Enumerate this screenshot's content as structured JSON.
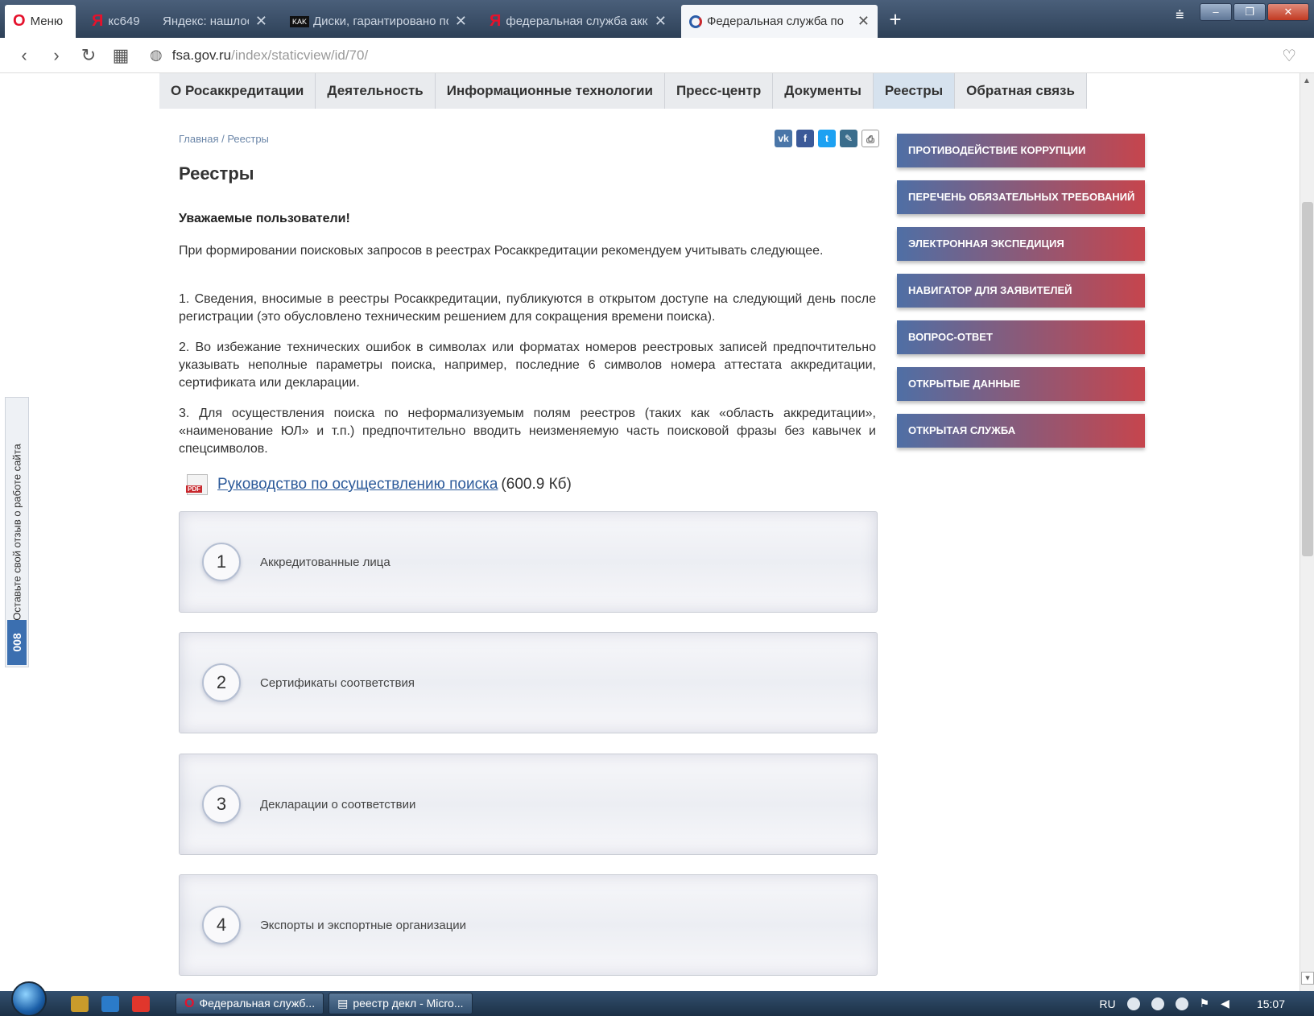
{
  "browser": {
    "tabs": [
      {
        "label": "Меню",
        "icon": "opera-logo-icon"
      },
      {
        "label": "кс649",
        "icon": "yandex-icon"
      },
      {
        "label": "Яндекс: нашлось",
        "icon": "none"
      },
      {
        "label": "Диски, гарантировано по",
        "icon": "kak-site-icon"
      },
      {
        "label": "федеральная служба акк",
        "icon": "yandex-icon"
      },
      {
        "label": "Федеральная служба по",
        "icon": "fsa-logo-icon",
        "active": true
      }
    ],
    "new_tab": "+",
    "url_host": "fsa.gov.ru",
    "url_path": "/index/staticview/id/70/"
  },
  "site_nav": [
    "О Росаккредитации",
    "Деятельность",
    "Информационные технологии",
    "Пресс-центр",
    "Документы",
    "Реестры",
    "Обратная связь"
  ],
  "breadcrumb": "Главная / Реестры",
  "share": {
    "vk": "vk",
    "fb": "f",
    "tw": "t",
    "ed": "✎",
    "pr": "⎙"
  },
  "page": {
    "title": "Реестры",
    "greeting": "Уважаемые пользователи!",
    "paragraphs": [
      "При формировании поисковых запросов в реестрах Росаккредитации рекомендуем учитывать следующее.",
      "1. Сведения, вносимые в реестры Росаккредитации, публикуются в открытом доступе на следующий день после регистрации (это обусловлено техническим решением для сокращения времени поиска).",
      "2. Во избежание технических ошибок в символах или форматах номеров реестровых записей предпочтительно указывать неполные параметры поиска, например, последние 6 символов номера аттестата аккредитации, сертификата или декларации.",
      "3. Для осуществления поиска по неформализуемым полям реестров (таких как «область аккредитации», «наименование ЮЛ» и т.п.) предпочтительно вводить неизменяемую часть поисковой фразы без кавычек и спецсимволов."
    ],
    "guide_link": "Руководство по осуществлению поиска",
    "guide_size": "(600.9 Кб)"
  },
  "registries": [
    {
      "num": "1",
      "label": "Аккредитованные лица"
    },
    {
      "num": "2",
      "label": "Сертификаты соответствия"
    },
    {
      "num": "3",
      "label": "Декларации о соответствии"
    },
    {
      "num": "4",
      "label": "Экспорты и экспортные организации"
    }
  ],
  "sidebar": [
    "Противодействие коррупции",
    "Перечень обязательных требований",
    "Электронная экспедиция",
    "Навигатор для заявителей",
    "Вопрос-ответ",
    "Открытые данные",
    "Открытая служба"
  ],
  "feedback": {
    "text": "Оставьте свой отзыв о работе сайта",
    "count": "008"
  },
  "taskbar": {
    "items": [
      "Федеральная служб...",
      "реестр декл - Micro..."
    ],
    "lang": "RU",
    "time": "15:07"
  },
  "colors": {
    "accent_start": "#4f6fa5",
    "accent_end": "#c6454d",
    "link": "#2c5a9a"
  }
}
